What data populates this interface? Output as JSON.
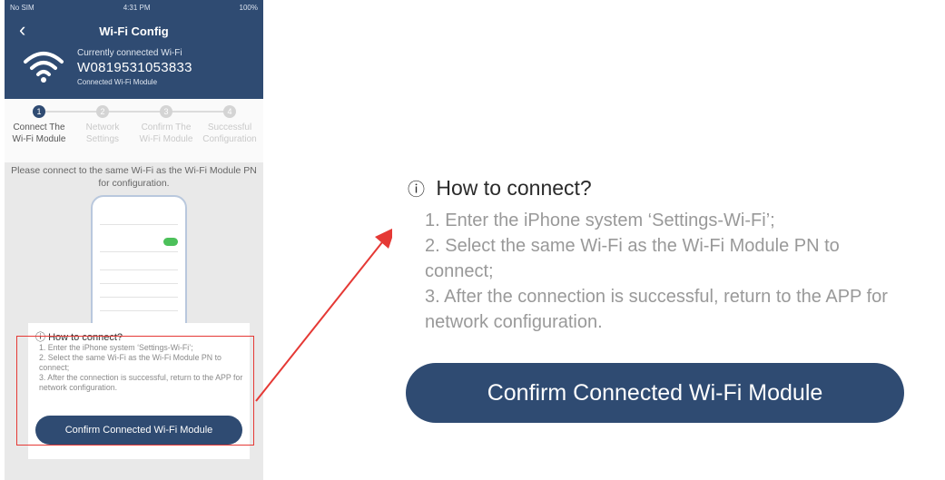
{
  "status_bar": {
    "carrier": "No SIM",
    "time": "4:31 PM",
    "battery": "100%"
  },
  "header": {
    "title": "Wi-Fi Config",
    "current_label": "Currently connected Wi-Fi",
    "current_ssid": "W0819531053833",
    "current_sub": "Connected Wi-Fi Module"
  },
  "steps": [
    {
      "number": "1",
      "label": "Connect The Wi-Fi Module",
      "active": true
    },
    {
      "number": "2",
      "label": "Network Settings",
      "active": false
    },
    {
      "number": "3",
      "label": "Confirm The Wi-Fi Module",
      "active": false
    },
    {
      "number": "4",
      "label": "Successful Configuration",
      "active": false
    }
  ],
  "instruction": "Please connect to the same Wi-Fi as the Wi-Fi Module PN for configuration.",
  "how_to": {
    "title": "How to connect?",
    "line1": "1. Enter the iPhone system ‘Settings-Wi-Fi’;",
    "line2": "2. Select the same Wi-Fi as the Wi-Fi Module PN to connect;",
    "line3": "3. After the connection is successful, return to the APP for network configuration.",
    "button": "Confirm Connected Wi-Fi Module"
  },
  "colors": {
    "primary": "#2f4b72",
    "highlight": "#e53935",
    "toggle": "#4cc05a"
  },
  "icons": [
    "back-icon",
    "wifi-icon",
    "warning-icon",
    "arrow-annotation"
  ]
}
